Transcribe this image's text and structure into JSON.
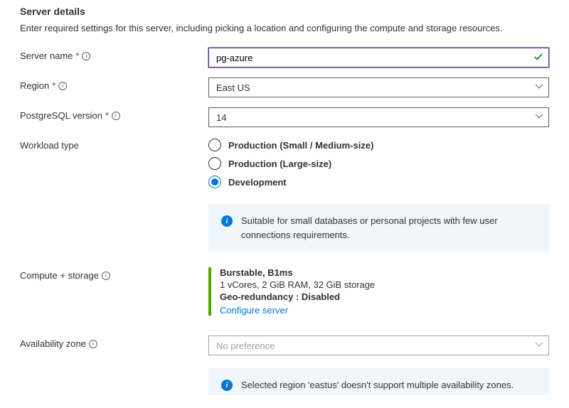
{
  "header": {
    "title": "Server details",
    "description": "Enter required settings for this server, including picking a location and configuring the compute and storage resources."
  },
  "fields": {
    "server_name": {
      "label": "Server name",
      "value": "pg-azure"
    },
    "region": {
      "label": "Region",
      "value": "East US"
    },
    "pg_version": {
      "label": "PostgreSQL version",
      "value": "14"
    },
    "workload_type": {
      "label": "Workload type",
      "options": {
        "prod_small": "Production (Small / Medium-size)",
        "prod_large": "Production (Large-size)",
        "dev": "Development"
      }
    },
    "compute_storage": {
      "label": "Compute + storage",
      "tier": "Burstable, B1ms",
      "spec": "1 vCores, 2 GiB RAM, 32 GiB storage",
      "geo": "Geo-redundancy : Disabled",
      "configure_link": "Configure server"
    },
    "availability_zone": {
      "label": "Availability zone",
      "value": "No preference"
    }
  },
  "banners": {
    "dev_info": "Suitable for small databases or personal projects with few user connections requirements.",
    "az_warning": "Selected region 'eastus' doesn't support multiple availability zones."
  }
}
